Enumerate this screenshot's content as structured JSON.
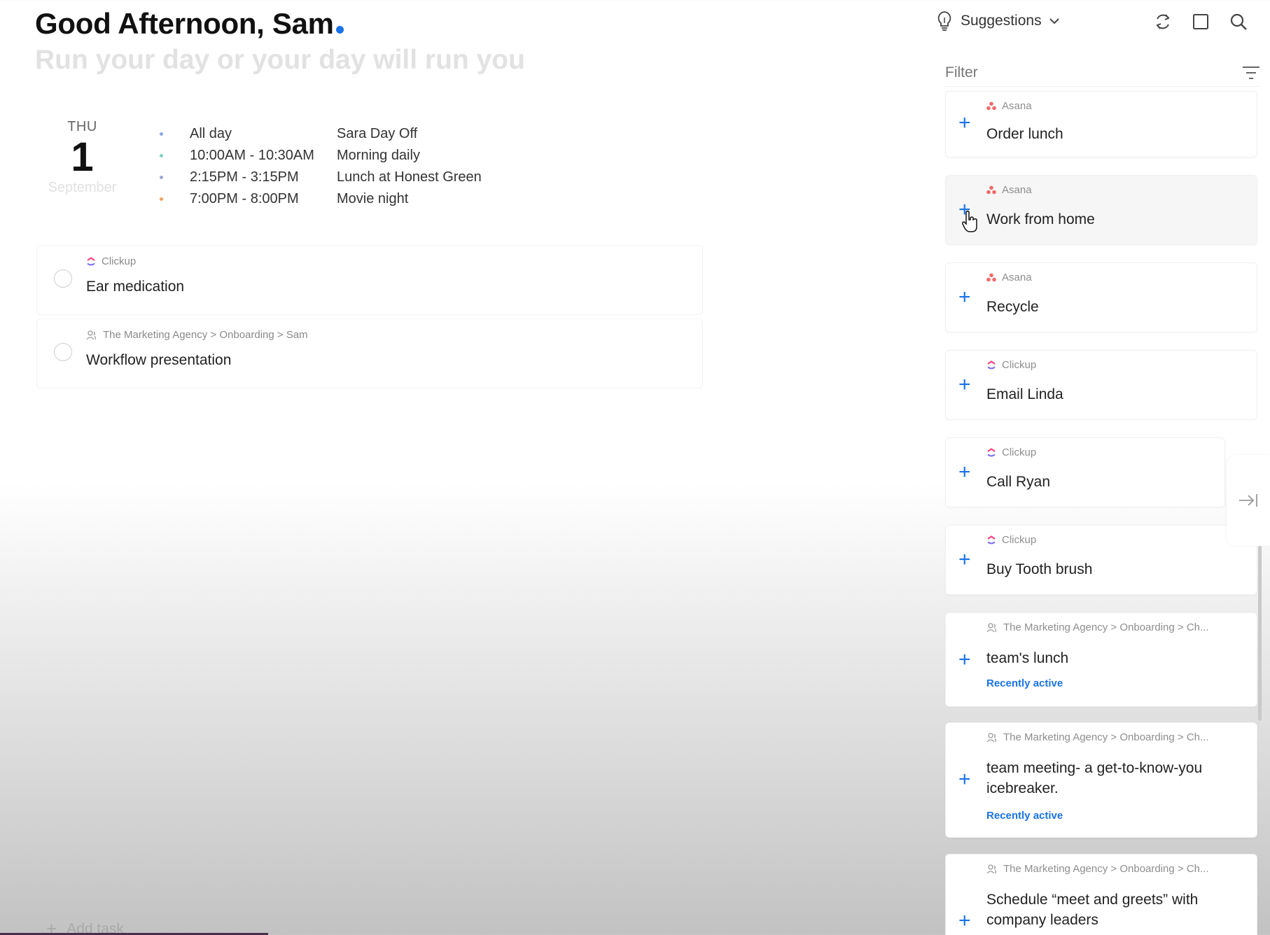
{
  "greeting": "Good Afternoon, Sam",
  "tagline": "Run your day or your day will run you",
  "date": {
    "dow": "THU",
    "day": "1",
    "month": "September"
  },
  "events": [
    {
      "time": "All day",
      "title": "Sara Day Off",
      "color": "#8aa9e6"
    },
    {
      "time": "10:00AM - 10:30AM",
      "title": "Morning daily",
      "color": "#7fd1c4"
    },
    {
      "time": "2:15PM - 3:15PM",
      "title": "Lunch at Honest Green",
      "color": "#9ba7d8"
    },
    {
      "time": "7:00PM - 8:00PM",
      "title": "Movie night",
      "color": "#f0a05a"
    }
  ],
  "tasks": [
    {
      "source": "Clickup",
      "source_icon": "clickup-icon",
      "title": "Ear medication"
    },
    {
      "source": "The Marketing Agency > Onboarding > Sam",
      "source_icon": "team-icon",
      "title": "Workflow presentation"
    }
  ],
  "add_task_label": "Add task",
  "panel": {
    "suggestions_label": "Suggestions",
    "filter_label": "Filter",
    "suggestions": [
      {
        "source": "Asana",
        "source_icon": "asana-icon",
        "title": "Order lunch"
      },
      {
        "source": "Asana",
        "source_icon": "asana-icon",
        "title": "Work from home"
      },
      {
        "source": "Asana",
        "source_icon": "asana-icon",
        "title": "Recycle"
      },
      {
        "source": "Clickup",
        "source_icon": "clickup-icon",
        "title": "Email Linda"
      },
      {
        "source": "Clickup",
        "source_icon": "clickup-icon",
        "title": "Call Ryan"
      },
      {
        "source": "Clickup",
        "source_icon": "clickup-icon",
        "title": "Buy Tooth brush"
      },
      {
        "source": "The Marketing Agency > Onboarding > Ch...",
        "source_icon": "team-icon",
        "title": "team's lunch",
        "badge": "Recently active"
      },
      {
        "source": "The Marketing Agency > Onboarding > Ch...",
        "source_icon": "team-icon",
        "title": "team meeting- a get-to-know-you icebreaker.",
        "badge": "Recently active"
      },
      {
        "source": "The Marketing Agency > Onboarding > Ch...",
        "source_icon": "team-icon",
        "title": "Schedule “meet and greets” with company leaders"
      }
    ]
  },
  "colors": {
    "accent": "#1a73e8",
    "asana": "#f06a6a",
    "clickup_a": "#7b68ee",
    "clickup_b": "#ff3d7f"
  }
}
